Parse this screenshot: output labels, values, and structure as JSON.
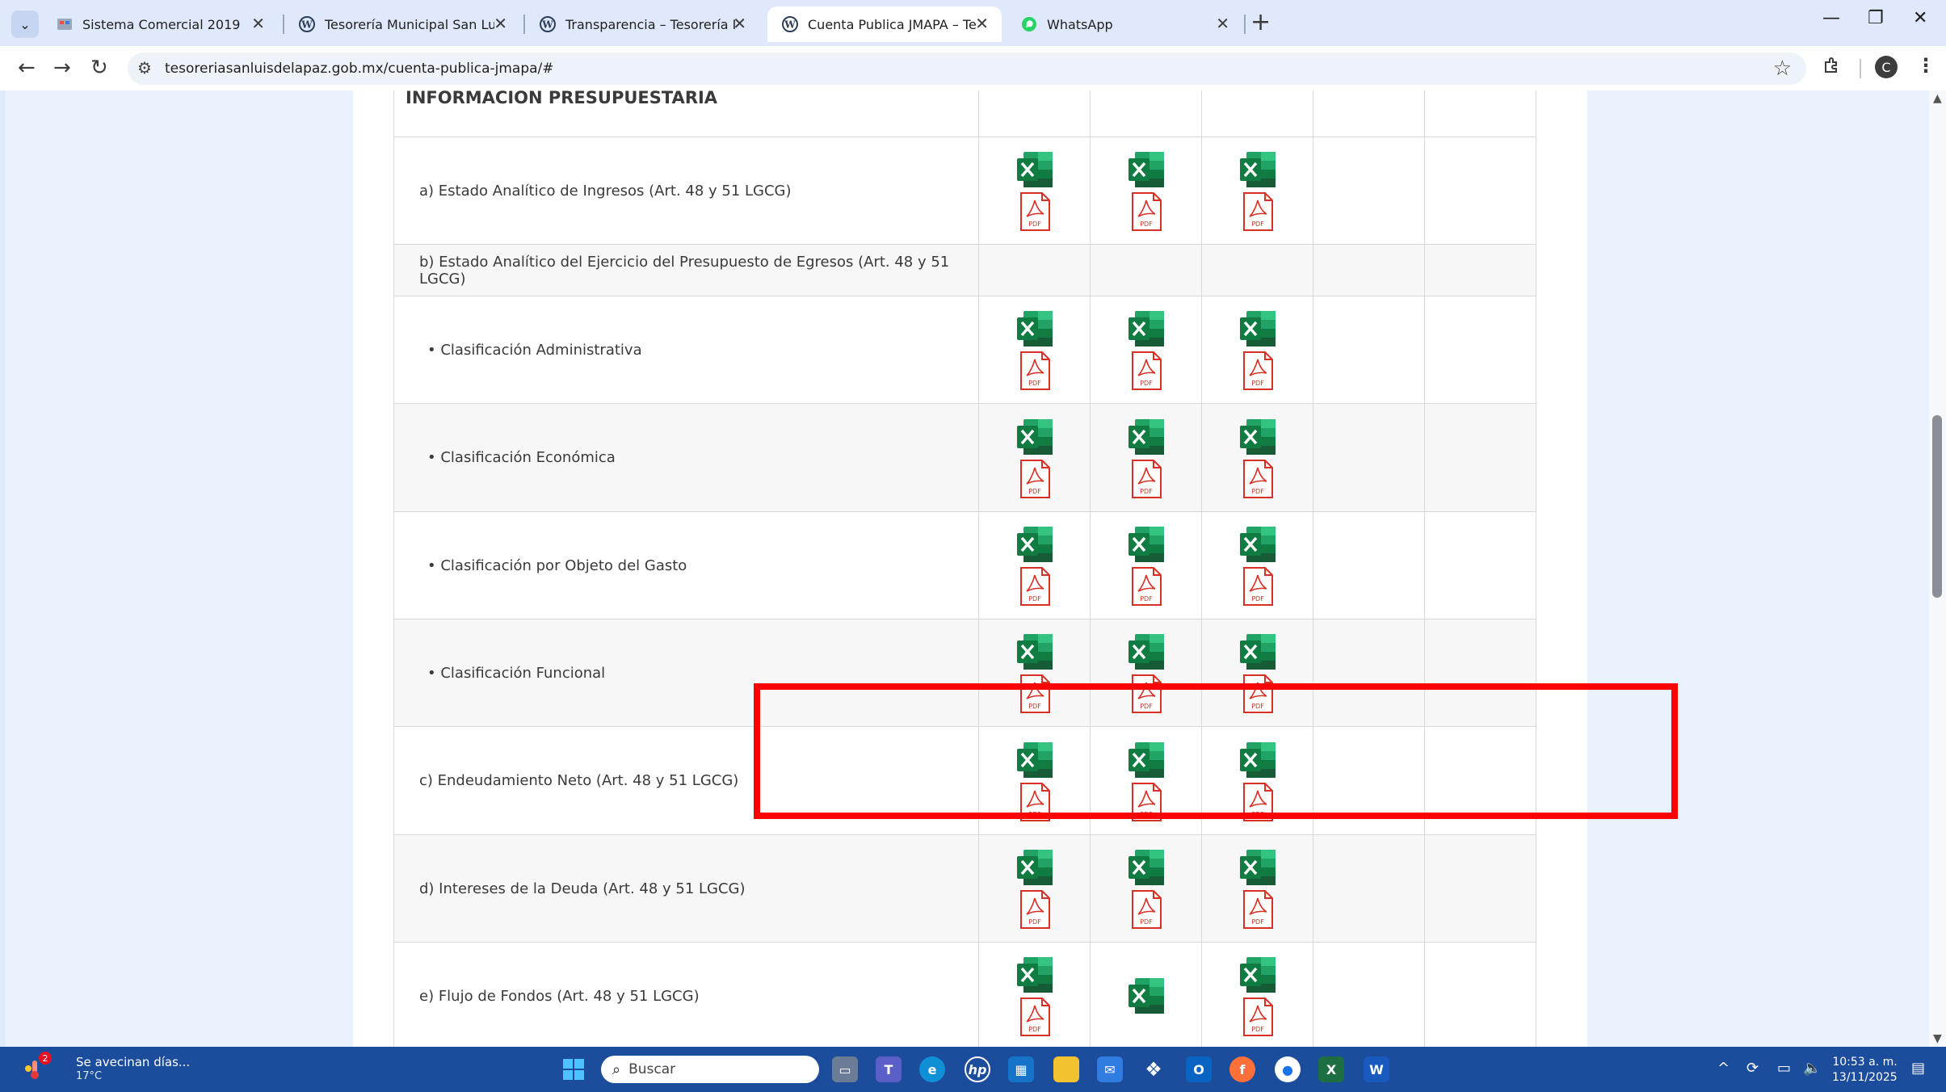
{
  "browser": {
    "tabs": [
      {
        "title": "Sistema Comercial 2019",
        "active": false,
        "favicon": "sistema-icon"
      },
      {
        "title": "Tesorería Municipal San Luis de",
        "active": false,
        "favicon": "wordpress-icon"
      },
      {
        "title": "Transparencia – Tesorería Munic",
        "active": false,
        "favicon": "wordpress-icon"
      },
      {
        "title": "Cuenta Publica JMAPA – Tesore",
        "active": true,
        "favicon": "wordpress-icon"
      },
      {
        "title": "WhatsApp",
        "active": false,
        "favicon": "whatsapp-icon"
      }
    ],
    "url": "tesoreriasanluisdelapaz.gob.mx/cuenta-publica-jmapa/#",
    "profile_initial": "C"
  },
  "page": {
    "section_title": "INFORMACION PRESUPUESTARIA",
    "rows": [
      {
        "label": "a) Estado Analítico de Ingresos (Art. 48 y 51 LGCG)",
        "bullet": false,
        "shaded": false,
        "files": [
          [
            "xls",
            "pdf"
          ],
          [
            "xls",
            "pdf"
          ],
          [
            "xls",
            "pdf"
          ]
        ]
      },
      {
        "label": "b) Estado Analítico del Ejercicio del Presupuesto de Egresos (Art. 48 y 51 LGCG)",
        "bullet": false,
        "shaded": true,
        "files": [
          [],
          [],
          []
        ]
      },
      {
        "label": "Clasificación Administrativa",
        "bullet": true,
        "shaded": false,
        "files": [
          [
            "xls",
            "pdf"
          ],
          [
            "xls",
            "pdf"
          ],
          [
            "xls",
            "pdf"
          ]
        ]
      },
      {
        "label": "Clasificación Económica",
        "bullet": true,
        "shaded": true,
        "files": [
          [
            "xls",
            "pdf"
          ],
          [
            "xls",
            "pdf"
          ],
          [
            "xls",
            "pdf"
          ]
        ]
      },
      {
        "label": "Clasificación por Objeto del Gasto",
        "bullet": true,
        "shaded": false,
        "files": [
          [
            "xls",
            "pdf"
          ],
          [
            "xls",
            "pdf"
          ],
          [
            "xls",
            "pdf"
          ]
        ]
      },
      {
        "label": "Clasificación Funcional",
        "bullet": true,
        "shaded": true,
        "highlighted": true,
        "files": [
          [
            "xls",
            "pdf"
          ],
          [
            "xls",
            "pdf"
          ],
          [
            "xls",
            "pdf"
          ]
        ]
      },
      {
        "label": "c) Endeudamiento Neto (Art. 48 y 51 LGCG)",
        "bullet": false,
        "shaded": false,
        "files": [
          [
            "xls",
            "pdf"
          ],
          [
            "xls",
            "pdf"
          ],
          [
            "xls",
            "pdf"
          ]
        ]
      },
      {
        "label": "d) Intereses de la Deuda (Art. 48 y 51 LGCG)",
        "bullet": false,
        "shaded": true,
        "files": [
          [
            "xls",
            "pdf"
          ],
          [
            "xls",
            "pdf"
          ],
          [
            "xls",
            "pdf"
          ]
        ]
      },
      {
        "label": "e) Flujo de Fondos (Art. 48 y 51 LGCG)",
        "bullet": false,
        "shaded": false,
        "files": [
          [
            "xls",
            "pdf"
          ],
          [
            "xls"
          ],
          [
            "xls",
            "pdf"
          ]
        ]
      }
    ],
    "bullet_char": "•",
    "highlight_color": "#ff0000"
  },
  "taskbar": {
    "weather_title": "Se avecinan días...",
    "weather_temp": "17°C",
    "weather_badge": "2",
    "search_placeholder": "Buscar",
    "time": "10:53 a. m.",
    "date": "13/11/2025"
  }
}
